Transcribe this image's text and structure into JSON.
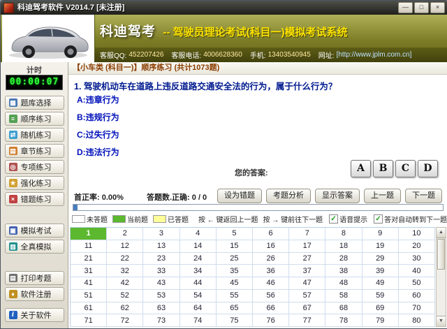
{
  "window": {
    "title": "科迪驾考软件 V2014.7 [未注册]",
    "minimize": "—",
    "maximize": "□",
    "close": "×"
  },
  "header": {
    "brand": "科迪驾考",
    "subtitle": "-- 驾驶员理论考试(科目一)模拟考试系统",
    "contact": {
      "qq_label": "客服QQ:",
      "qq_value": "452207426",
      "phone_label": "客服电话:",
      "phone_value": "4006628360",
      "mobile_label": "手机:",
      "mobile_value": "13403540945",
      "site_label": "网址:",
      "site_value": "[http://www.jplm.com.cn]"
    }
  },
  "sidebar": {
    "timer_label": "计时",
    "timer_value": "00:00:07",
    "items": [
      {
        "label": "题库选择",
        "icon": "▦"
      },
      {
        "label": "顺序练习",
        "icon": "≡"
      },
      {
        "label": "随机练习",
        "icon": "⇄"
      },
      {
        "label": "章节练习",
        "icon": "▤"
      },
      {
        "label": "专项练习",
        "icon": "◎"
      },
      {
        "label": "强化练习",
        "icon": "★"
      },
      {
        "label": "错题练习",
        "icon": "×"
      },
      {
        "label": "模拟考试",
        "icon": "▣"
      },
      {
        "label": "全真模拟",
        "icon": "▥"
      },
      {
        "label": "打印考题",
        "icon": "▤"
      },
      {
        "label": "软件注册",
        "icon": "♦"
      },
      {
        "label": "关于软件",
        "icon": "i"
      }
    ]
  },
  "main": {
    "breadcrumb": "【小车类 (科目一)】顺序练习 (共计1073题)",
    "question": "1. 驾驶机动车在道路上违反道路交通安全法的行为，属于什么行为？",
    "options": [
      "A:违章行为",
      "B:违规行为",
      "C:过失行为",
      "D:违法行为"
    ],
    "your_answer_label": "您的答案:",
    "answer_buttons": [
      "A",
      "B",
      "C",
      "D"
    ],
    "stats": {
      "first_rate": "首正率: 0.00%",
      "answered": "答题数.正确: 0 / 0"
    },
    "actions": {
      "mark_wrong": "设为错题",
      "analysis": "考题分析",
      "show_answer": "显示答案",
      "prev": "上一题",
      "next": "下一题"
    },
    "legend": {
      "unanswered": "未答题",
      "current": "当前题",
      "answered": "已答题",
      "hint_prev": "按 ← 键返回上一题",
      "hint_next": "按 → 键前往下一题",
      "voice": "语音提示",
      "auto_next": "答对自动转到下一题"
    },
    "grid": {
      "current": 1,
      "rows": [
        [
          1,
          2,
          3,
          4,
          5,
          6,
          7,
          8,
          9,
          10
        ],
        [
          11,
          12,
          13,
          14,
          15,
          16,
          17,
          18,
          19,
          20
        ],
        [
          21,
          22,
          23,
          24,
          25,
          26,
          27,
          28,
          29,
          30
        ],
        [
          31,
          32,
          33,
          34,
          35,
          36,
          37,
          38,
          39,
          40
        ],
        [
          41,
          42,
          43,
          44,
          45,
          46,
          47,
          48,
          49,
          50
        ],
        [
          51,
          52,
          53,
          54,
          55,
          56,
          57,
          58,
          59,
          60
        ],
        [
          61,
          62,
          63,
          64,
          65,
          66,
          67,
          68,
          69,
          70
        ],
        [
          71,
          72,
          73,
          74,
          75,
          76,
          77,
          78,
          79,
          80
        ]
      ]
    }
  },
  "colors": {
    "banner_olive": "#7c7c26",
    "title_yellow": "#ffe400",
    "timer_green": "#33ff33",
    "legend_current": "#5cb82e",
    "legend_answered": "#ffff99",
    "question_blue": "#001a8f"
  }
}
